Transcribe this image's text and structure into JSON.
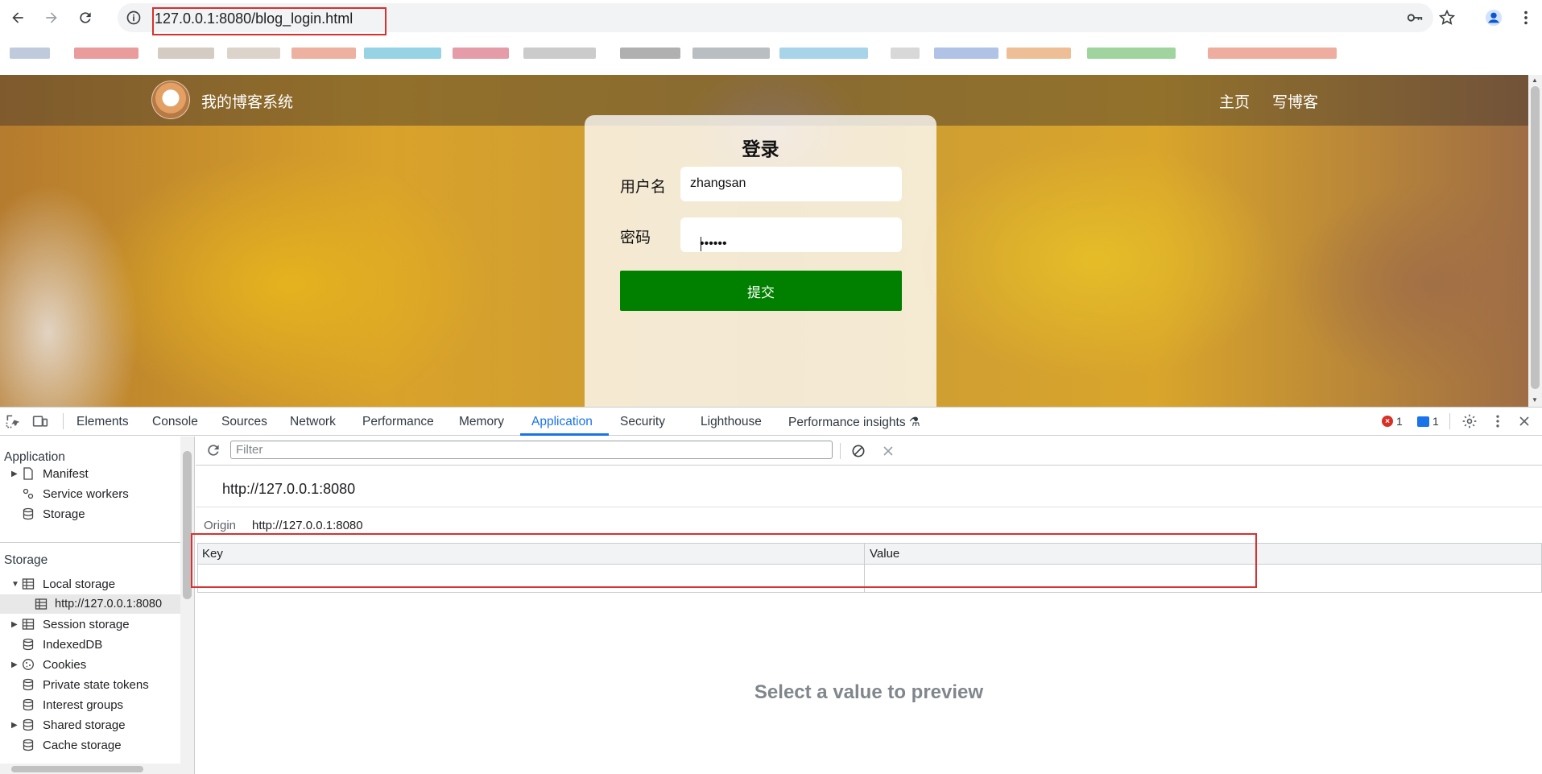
{
  "browser": {
    "url": "127.0.0.1:8080/blog_login.html"
  },
  "page": {
    "site_title": "我的博客系统",
    "nav_links": [
      "主页",
      "写博客"
    ],
    "login": {
      "title": "登录",
      "username_label": "用户名",
      "username_value": "zhangsan",
      "password_label": "密码",
      "password_value": "••••••",
      "submit_label": "提交"
    }
  },
  "devtools": {
    "tabs": [
      "Elements",
      "Console",
      "Sources",
      "Network",
      "Performance",
      "Memory",
      "Application",
      "Security",
      "Lighthouse",
      "Performance insights"
    ],
    "active_tab": "Application",
    "error_count": "1",
    "message_count": "1",
    "sidebar": {
      "application_section": "Application",
      "application_items": [
        "Manifest",
        "Service workers",
        "Storage"
      ],
      "storage_section": "Storage",
      "storage_items": [
        "Local storage",
        "http://127.0.0.1:8080",
        "Session storage",
        "IndexedDB",
        "Cookies",
        "Private state tokens",
        "Interest groups",
        "Shared storage",
        "Cache storage"
      ]
    },
    "main": {
      "filter_placeholder": "Filter",
      "origin_header": "http://127.0.0.1:8080",
      "origin_label": "Origin",
      "origin_value": "http://127.0.0.1:8080",
      "columns": [
        "Key",
        "Value"
      ],
      "preview_text": "Select a value to preview"
    }
  }
}
